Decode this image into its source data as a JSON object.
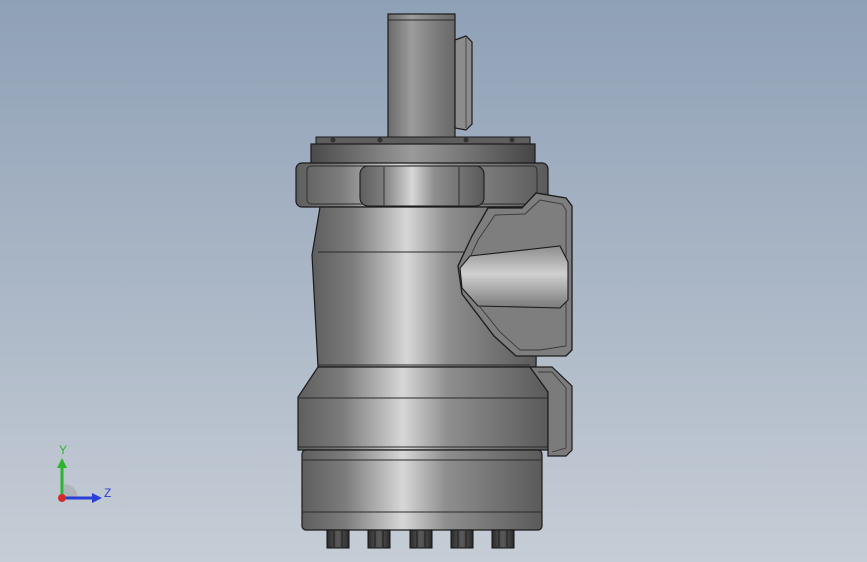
{
  "triad": {
    "y_label": "Y",
    "z_label": "Z",
    "colors": {
      "y": "#2db52d",
      "z": "#2a3fd6",
      "x": "#d62a2a"
    }
  },
  "model": {
    "body_color": "#8a8a8a",
    "dark_color": "#3e3e3e",
    "edge_color": "#1b1b1b"
  }
}
